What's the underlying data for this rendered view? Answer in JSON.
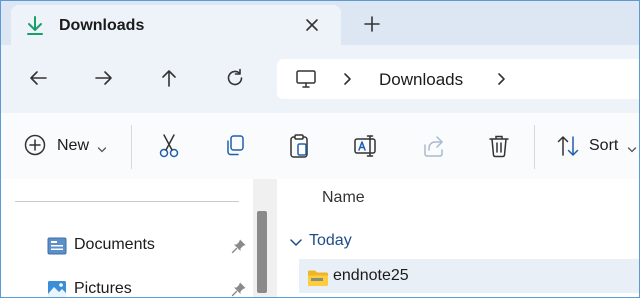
{
  "tab": {
    "title": "Downloads"
  },
  "address": {
    "crumb": "Downloads"
  },
  "toolbar": {
    "new_label": "New",
    "sort_label": "Sort"
  },
  "sidebar": {
    "items": [
      {
        "label": "Documents"
      },
      {
        "label": "Pictures"
      }
    ]
  },
  "content": {
    "column_header": "Name",
    "group_label": "Today",
    "files": [
      {
        "name": "endnote25"
      }
    ]
  },
  "colors": {
    "accent": "#1a9e6a",
    "selection": "#e8eff7",
    "group": "#1f4d8a"
  }
}
